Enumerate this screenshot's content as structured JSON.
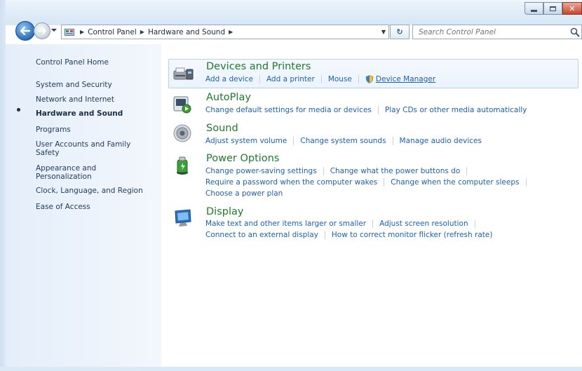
{
  "window": {
    "caption_buttons": {
      "minimize_icon": "minimize-icon",
      "maximize_icon": "maximize-icon",
      "close_glyph": "✕"
    }
  },
  "nav": {
    "crumbs": [
      "Control Panel",
      "Hardware and Sound"
    ],
    "refresh_glyph": "↻",
    "search_placeholder": "Search Control Panel"
  },
  "sidebar": {
    "items": [
      {
        "label": "Control Panel Home"
      },
      {
        "label": "System and Security"
      },
      {
        "label": "Network and Internet"
      },
      {
        "label": "Hardware and Sound",
        "current": true
      },
      {
        "label": "Programs"
      },
      {
        "label": "User Accounts and Family"
      },
      {
        "label": "Safety"
      },
      {
        "label": "Appearance and"
      },
      {
        "label": "Personalization"
      },
      {
        "label": "Clock, Language, and Region"
      },
      {
        "label": "Ease of Access"
      }
    ]
  },
  "categories": [
    {
      "title": "Devices and Printers",
      "icon": "printer-icon",
      "rows": [
        [
          "Add a device",
          "Add a printer",
          "Mouse",
          "Device Manager"
        ]
      ]
    },
    {
      "title": "AutoPlay",
      "icon": "autoplay-icon",
      "rows": [
        [
          "Change default settings for media or devices",
          "Play CDs or other media automatically"
        ]
      ]
    },
    {
      "title": "Sound",
      "icon": "speaker-icon",
      "rows": [
        [
          "Adjust system volume",
          "Change system sounds",
          "Manage audio devices"
        ]
      ]
    },
    {
      "title": "Power Options",
      "icon": "battery-icon",
      "rows": [
        [
          "Change power-saving settings",
          "Change what the power buttons do"
        ],
        [
          "Require a password when the computer wakes",
          "Change when the computer sleeps"
        ],
        [
          "Choose a power plan"
        ]
      ]
    },
    {
      "title": "Display",
      "icon": "monitor-icon",
      "rows": [
        [
          "Make text and other items larger or smaller",
          "Adjust screen resolution"
        ],
        [
          "Connect to an external display",
          "How to correct monitor flicker (refresh rate)"
        ]
      ]
    }
  ],
  "colors": {
    "link": "#1e5fb0",
    "category_title": "#1e7a2c",
    "sidebar_text": "#1e395b",
    "close_button": "#c7442e"
  }
}
